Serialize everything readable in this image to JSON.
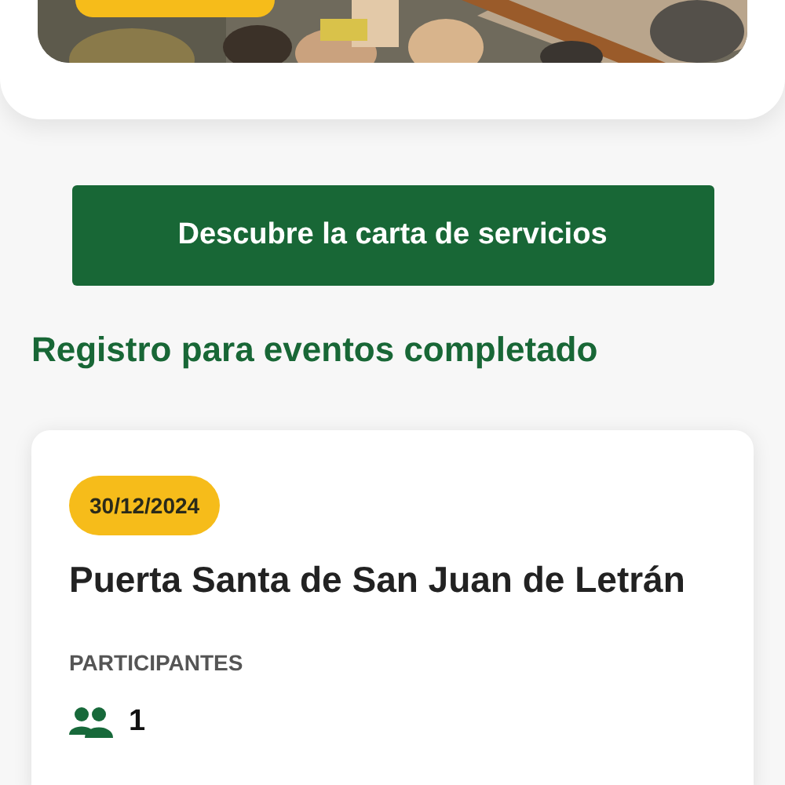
{
  "services_button": {
    "label": "Descubre la carta de servicios"
  },
  "section_title": "Registro para eventos completado",
  "events": [
    {
      "date": "30/12/2024",
      "title": "Puerta Santa de San Juan de Letrán",
      "participants_label": "PARTICIPANTES",
      "participants": "1"
    }
  ]
}
